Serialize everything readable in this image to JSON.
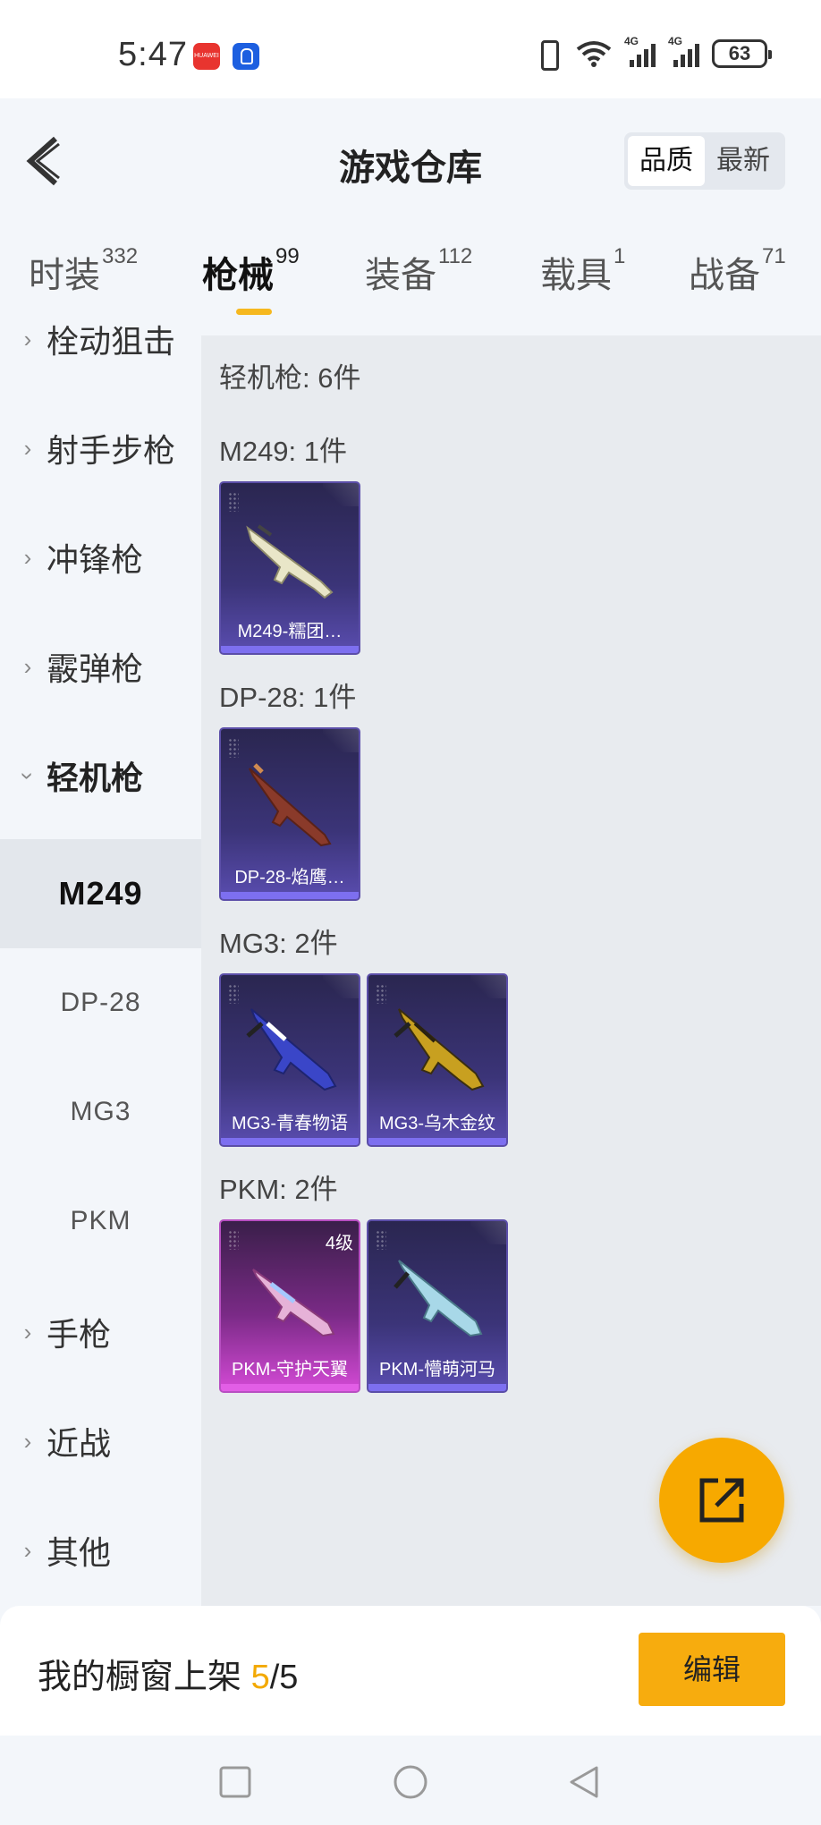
{
  "status_bar": {
    "time": "5:47",
    "app_icon_1_label": "HUAWEI",
    "signal_label": "4G",
    "battery": "63"
  },
  "header": {
    "title": "游戏仓库",
    "sort_options": [
      "品质",
      "最新"
    ]
  },
  "category_tabs": [
    {
      "label": "时装",
      "count": "332"
    },
    {
      "label": "枪械",
      "count": "99"
    },
    {
      "label": "装备",
      "count": "112"
    },
    {
      "label": "载具",
      "count": "1"
    },
    {
      "label": "战备",
      "count": "71"
    }
  ],
  "sidebar": {
    "items": [
      {
        "label": "栓动狙击"
      },
      {
        "label": "射手步枪"
      },
      {
        "label": "冲锋枪"
      },
      {
        "label": "霰弹枪"
      },
      {
        "label": "轻机枪"
      }
    ],
    "sub_items": [
      {
        "label": "M249"
      },
      {
        "label": "DP-28"
      },
      {
        "label": "MG3"
      },
      {
        "label": "PKM"
      }
    ],
    "items_after": [
      {
        "label": "手枪"
      },
      {
        "label": "近战"
      },
      {
        "label": "其他"
      }
    ]
  },
  "content": {
    "summary": "轻机枪: 6件",
    "groups": [
      {
        "label": "M249: 1件",
        "cards": [
          {
            "name": "M249-糯团…"
          }
        ]
      },
      {
        "label": "DP-28: 1件",
        "cards": [
          {
            "name": "DP-28-焰鹰…"
          }
        ]
      },
      {
        "label": "MG3: 2件",
        "cards": [
          {
            "name": "MG3-青春物语"
          },
          {
            "name": "MG3-乌木金纹"
          }
        ]
      },
      {
        "label": "PKM: 2件",
        "cards": [
          {
            "name": "PKM-守护天翼",
            "level": "4级"
          },
          {
            "name": "PKM-懵萌河马"
          }
        ]
      }
    ]
  },
  "bottom": {
    "showcase_prefix": "我的橱窗上架 ",
    "showcase_count": "5",
    "showcase_total": "/5",
    "edit_label": "编辑"
  },
  "colors": {
    "accent": "#f7ac0e",
    "card_purple": "#3b3478",
    "card_pink": "#d44ad6"
  }
}
